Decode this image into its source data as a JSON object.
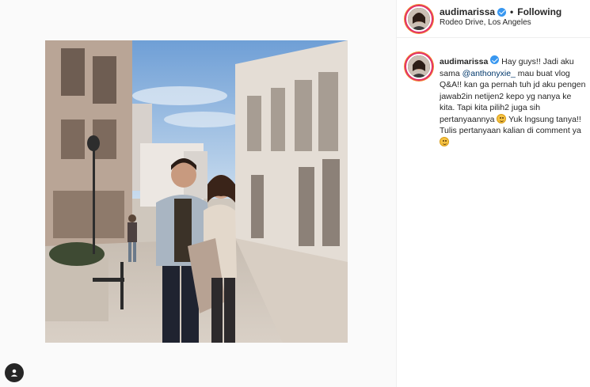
{
  "header": {
    "username": "audimarissa",
    "separator": "•",
    "follow_state": "Following",
    "location": "Rodeo Drive, Los Angeles"
  },
  "caption": {
    "username": "audimarissa",
    "text_1": "Hay guys!! Jadi aku sama ",
    "mention": "@anthonyxie_",
    "text_2": " mau buat vlog Q&A!! kan ga pernah tuh jd aku pengen jawab2in netijen2 kepo yg nanya ke kita. Tapi kita pilih2 juga sih pertanyaannya ",
    "text_3": " Yuk lngsung tanya!! Tulis pertanyaan kalian di comment ya",
    "emoji_1": "grinning-face",
    "emoji_2": "grinning-face"
  },
  "icons": {
    "verified": "verified-badge-icon",
    "tag_people": "user-tag-icon"
  },
  "colors": {
    "verified_blue": "#3897f0",
    "text": "#262626",
    "mention": "#00376b",
    "story_ring": "#e1306c"
  }
}
